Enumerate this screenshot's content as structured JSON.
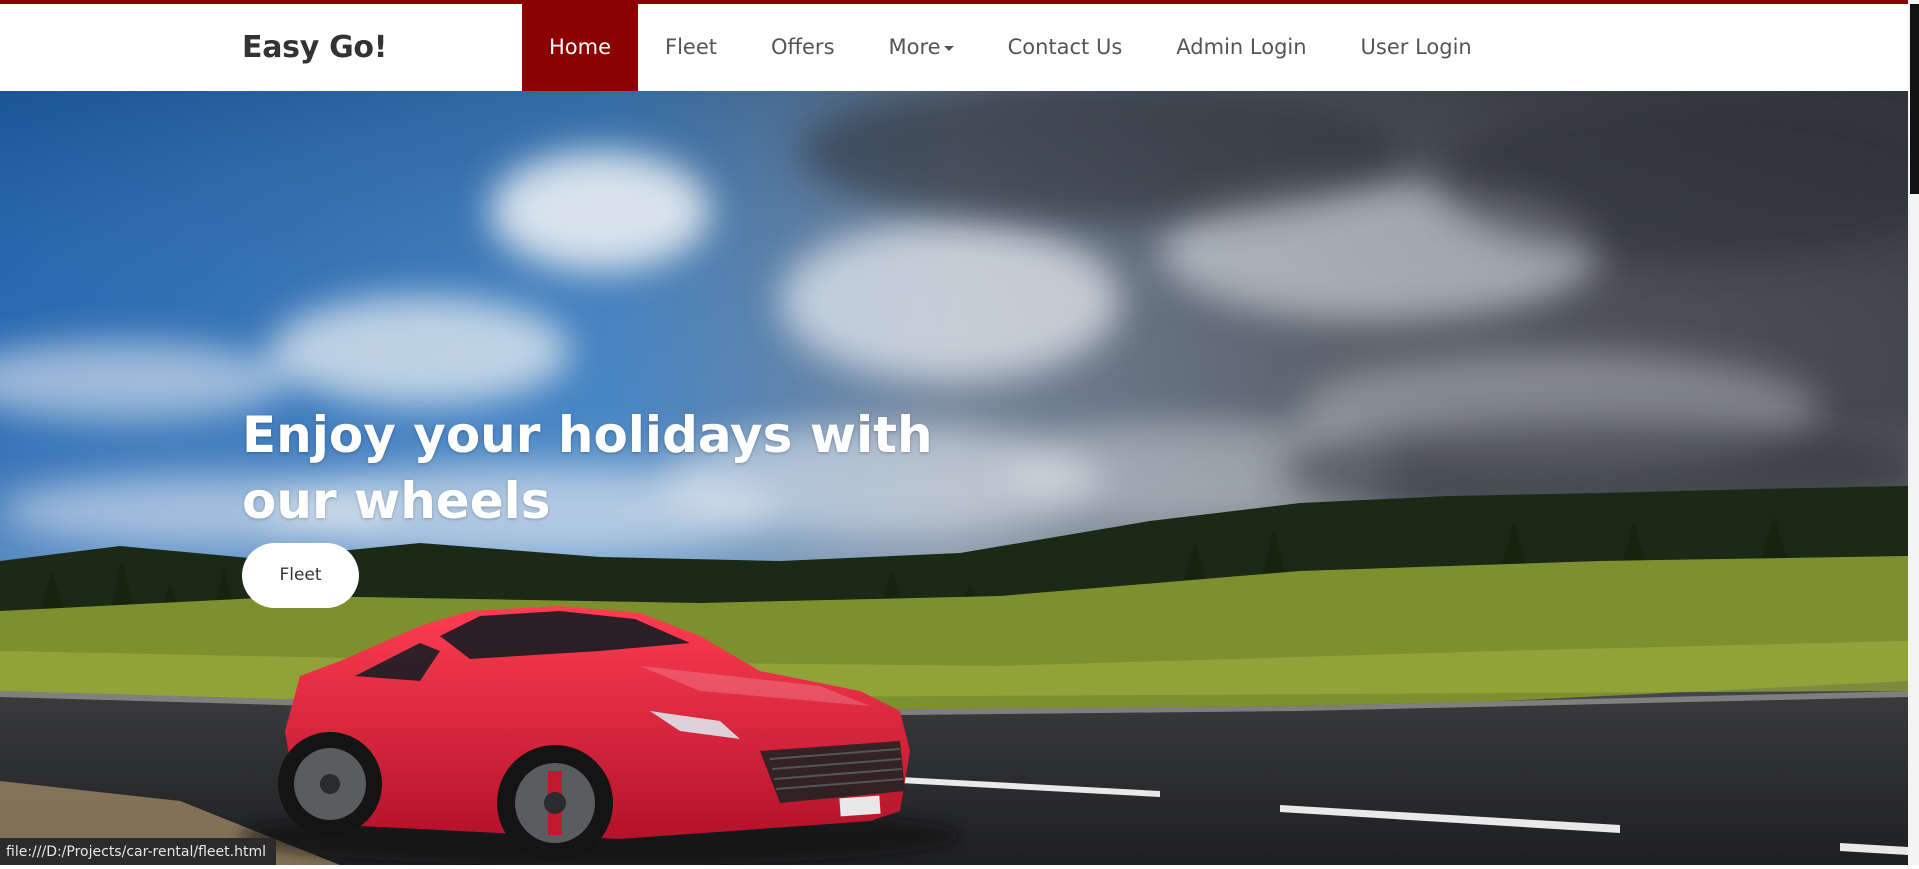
{
  "header": {
    "brand": "Easy Go!",
    "nav": [
      {
        "label": "Home",
        "active": true
      },
      {
        "label": "Fleet"
      },
      {
        "label": "Offers"
      },
      {
        "label": "More"
      },
      {
        "label": "Contact Us"
      },
      {
        "label": "Admin Login"
      },
      {
        "label": "User Login"
      }
    ]
  },
  "hero": {
    "headline_line1": "Enjoy your holidays with",
    "headline_line2": "our wheels",
    "button_label": "Fleet"
  },
  "status_bar": {
    "url": "file:///D:/Projects/car-rental/fleet.html"
  },
  "colors": {
    "accent": "#8b0000",
    "active_nav_text": "#ffffff",
    "nav_text": "#555555",
    "brand_text": "#333333"
  },
  "icons": {
    "more_dropdown": "caret-down-icon"
  }
}
